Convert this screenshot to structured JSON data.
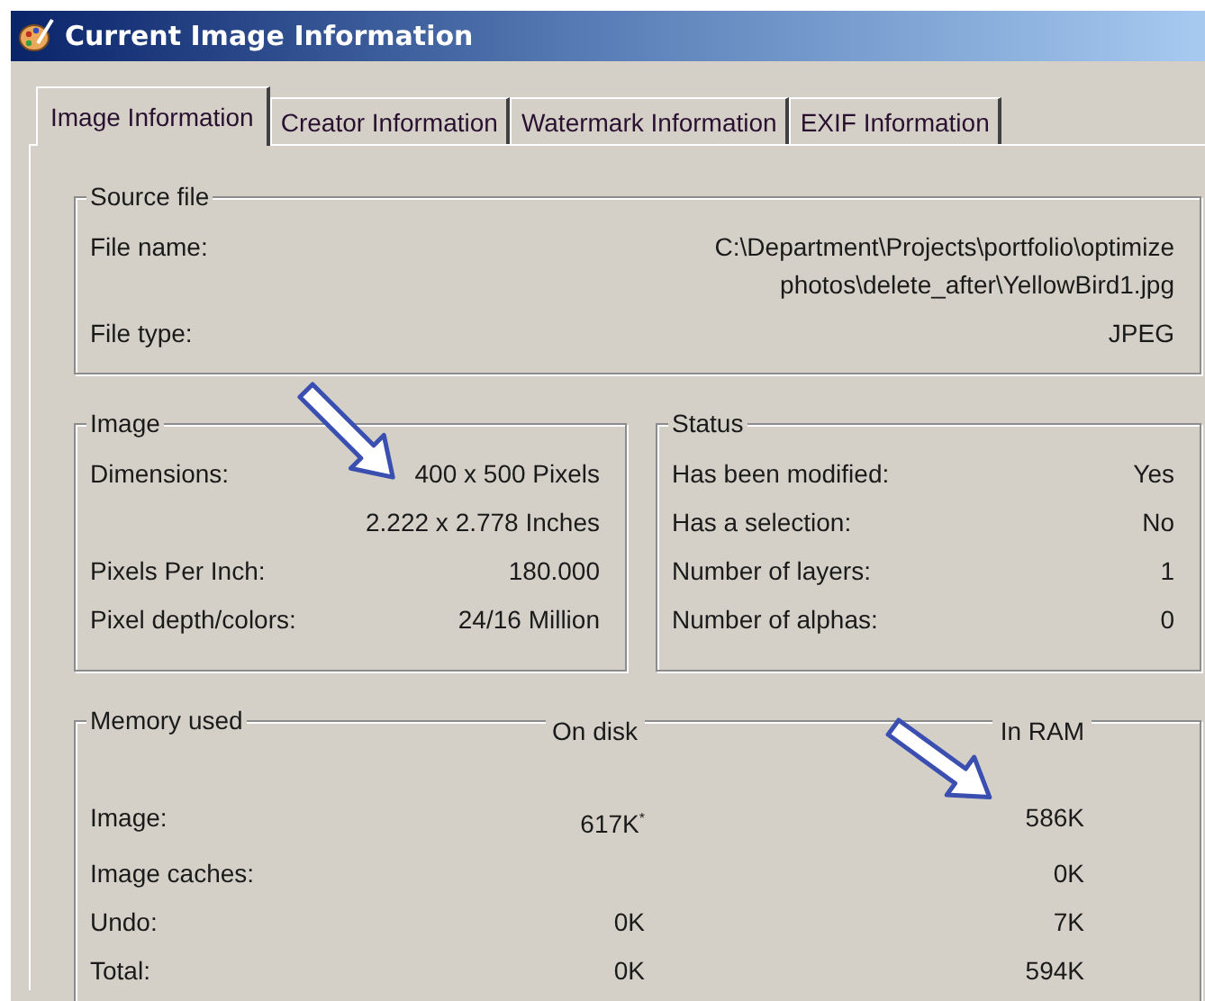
{
  "window": {
    "title": "Current Image Information"
  },
  "tabs": [
    {
      "label": "Image Information",
      "selected": true
    },
    {
      "label": "Creator Information",
      "selected": false
    },
    {
      "label": "Watermark Information",
      "selected": false
    },
    {
      "label": "EXIF Information",
      "selected": false
    }
  ],
  "source_file": {
    "legend": "Source file",
    "rows": [
      {
        "label": "File name:",
        "value": "C:\\Department\\Projects\\portfolio\\optimize photos\\delete_after\\YellowBird1.jpg"
      },
      {
        "label": "File type:",
        "value": "JPEG"
      }
    ]
  },
  "image": {
    "legend": "Image",
    "rows": [
      {
        "label": "Dimensions:",
        "value": "400 x 500 Pixels"
      },
      {
        "value": "2.222 x 2.778 Inches"
      },
      {
        "label": "Pixels Per Inch:",
        "value": "180.000"
      },
      {
        "label": "Pixel depth/colors:",
        "value": "24/16 Million"
      }
    ]
  },
  "status": {
    "legend": "Status",
    "rows": [
      {
        "label": "Has been modified:",
        "value": "Yes"
      },
      {
        "label": "Has a selection:",
        "value": "No"
      },
      {
        "label": "Number of layers:",
        "value": "1"
      },
      {
        "label": "Number of alphas:",
        "value": "0"
      }
    ]
  },
  "memory_used": {
    "legend": "Memory used",
    "columns": [
      "On disk",
      "In RAM"
    ],
    "rows": [
      {
        "label": "Image:",
        "on_disk": "617K$^{*}$",
        "in_ram": "586K"
      },
      {
        "label": "Image caches:",
        "in_ram": "0K"
      },
      {
        "label": "Undo:",
        "on_disk": "0K",
        "in_ram": "7K"
      },
      {
        "label": "Total:",
        "on_disk": "0K",
        "in_ram": "594K"
      }
    ]
  }
}
